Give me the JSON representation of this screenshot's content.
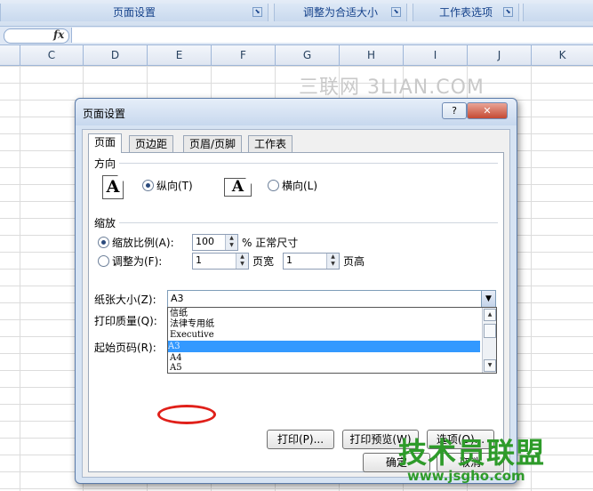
{
  "ribbon": {
    "groups": [
      {
        "label": "页面设置",
        "launcher": "⬊"
      },
      {
        "label": "调整为合适大小",
        "launcher": "⬊"
      },
      {
        "label": "工作表选项",
        "launcher": "⬊"
      }
    ]
  },
  "formula_bar": {
    "fx_label": "fx"
  },
  "columns": [
    "C",
    "D",
    "E",
    "F",
    "G",
    "H",
    "I",
    "J",
    "K"
  ],
  "watermark": "三联网 3LIAN.COM",
  "dialog": {
    "title": "页面设置",
    "help_label": "?",
    "close_label": "✕",
    "tabs": [
      "页面",
      "页边距",
      "页眉/页脚",
      "工作表"
    ],
    "orientation": {
      "section_label": "方向",
      "portrait_icon": "A",
      "portrait_label": "纵向(T)",
      "landscape_icon": "A",
      "landscape_label": "横向(L)"
    },
    "scaling": {
      "section_label": "缩放",
      "scale_label": "缩放比例(A):",
      "scale_value": "100",
      "scale_suffix": "% 正常尺寸",
      "fit_label": "调整为(F):",
      "fit_wide_value": "1",
      "fit_wide_label": "页宽",
      "fit_tall_value": "1",
      "fit_tall_label": "页高"
    },
    "paper_size_label": "纸张大小(Z):",
    "paper_size_value": "A3",
    "paper_options": [
      "信纸",
      "法律专用纸",
      "Executive",
      "A3",
      "A4",
      "A5"
    ],
    "print_quality_label": "打印质量(Q):",
    "first_page_label": "起始页码(R):",
    "buttons": {
      "print": "打印(P)...",
      "preview": "打印预览(W)",
      "options": "选项(O)...",
      "ok": "确定",
      "cancel": "取消"
    }
  },
  "brand": {
    "name": "技术员联盟",
    "url": "www.jsgho.com"
  }
}
